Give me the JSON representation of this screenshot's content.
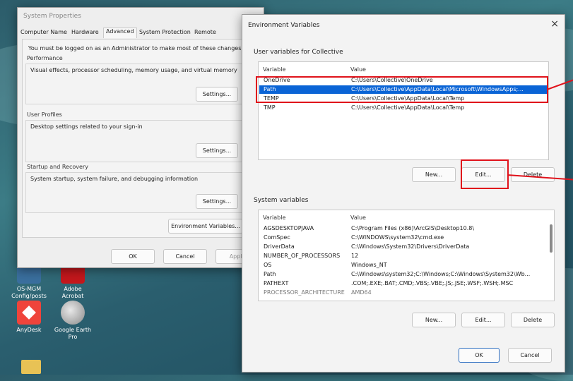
{
  "desktop": {
    "icons": [
      {
        "label": "OS-MGM\nConfig/posts",
        "glyph": "generic-app-icon"
      },
      {
        "label": "Adobe\nAcrobat",
        "glyph": "acrobat-icon"
      },
      {
        "label": "AnyDesk",
        "glyph": "anydesk-icon"
      },
      {
        "label": "Google Earth\nPro",
        "glyph": "google-earth-icon"
      }
    ],
    "accent_red": "#e0121b"
  },
  "system_properties": {
    "title": "System Properties",
    "tabs": [
      "Computer Name",
      "Hardware",
      "Advanced",
      "System Protection",
      "Remote"
    ],
    "active_tab": "Advanced",
    "admin_note": "You must be logged on as an Administrator to make most of these changes.",
    "performance": {
      "label": "Performance",
      "text": "Visual effects, processor scheduling, memory usage, and virtual memory",
      "button": "Settings..."
    },
    "user_profiles": {
      "label": "User Profiles",
      "text": "Desktop settings related to your sign-in",
      "button": "Settings..."
    },
    "startup_recovery": {
      "label": "Startup and Recovery",
      "text": "System startup, system failure, and debugging information",
      "button": "Settings..."
    },
    "env_button": "Environment Variables...",
    "ok": "OK",
    "cancel": "Cancel",
    "apply": "Apply"
  },
  "env_vars": {
    "title": "Environment Variables",
    "close_glyph": "×",
    "user_section": "User variables for Collective",
    "columns": {
      "variable": "Variable",
      "value": "Value"
    },
    "user_rows": [
      {
        "variable": "OneDrive",
        "value": "C:\\Users\\Collective\\OneDrive"
      },
      {
        "variable": "Path",
        "value": "C:\\Users\\Collective\\AppData\\Local\\Microsoft\\WindowsApps;..."
      },
      {
        "variable": "TEMP",
        "value": "C:\\Users\\Collective\\AppData\\Local\\Temp"
      },
      {
        "variable": "TMP",
        "value": "C:\\Users\\Collective\\AppData\\Local\\Temp"
      }
    ],
    "user_selected": "Path",
    "user_buttons": {
      "new": "New...",
      "edit": "Edit...",
      "delete": "Delete"
    },
    "system_section": "System variables",
    "system_rows": [
      {
        "variable": "AGSDESKTOPJAVA",
        "value": "C:\\Program Files (x86)\\ArcGIS\\Desktop10.8\\"
      },
      {
        "variable": "ComSpec",
        "value": "C:\\WINDOWS\\system32\\cmd.exe"
      },
      {
        "variable": "DriverData",
        "value": "C:\\Windows\\System32\\Drivers\\DriverData"
      },
      {
        "variable": "NUMBER_OF_PROCESSORS",
        "value": "12"
      },
      {
        "variable": "OS",
        "value": "Windows_NT"
      },
      {
        "variable": "Path",
        "value": "C:\\Windows\\system32;C:\\Windows;C:\\Windows\\System32\\Wb..."
      },
      {
        "variable": "PATHEXT",
        "value": ".COM;.EXE;.BAT;.CMD;.VBS;.VBE;.JS;.JSE;.WSF;.WSH;.MSC"
      },
      {
        "variable": "PROCESSOR_ARCHITECTURE",
        "value": "AMD64"
      }
    ],
    "system_buttons": {
      "new": "New...",
      "edit": "Edit...",
      "delete": "Delete"
    },
    "ok": "OK",
    "cancel": "Cancel",
    "selection_color": "#0a64d6"
  }
}
